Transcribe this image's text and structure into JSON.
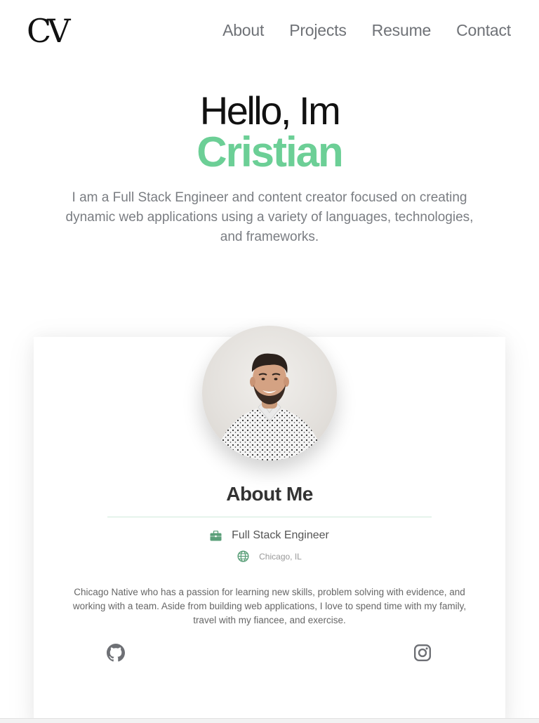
{
  "header": {
    "logo_text": "CV",
    "nav": [
      {
        "label": "About"
      },
      {
        "label": "Projects"
      },
      {
        "label": "Resume"
      },
      {
        "label": "Contact"
      }
    ]
  },
  "hero": {
    "greeting": "Hello, Im",
    "name": "Cristian",
    "description": "I am a Full Stack Engineer and content creator focused on creating dynamic web applications using a variety of languages, technologies, and frameworks."
  },
  "about": {
    "title": "About Me",
    "job_title": "Full Stack Engineer",
    "location": "Chicago, IL",
    "bio": "Chicago Native who has a passion for learning new skills, problem solving with evidence, and working with a team. Aside from building web applications, I love to spend time with my family, travel with my fiancee, and exercise.",
    "job_icon": "briefcase-icon",
    "location_icon": "globe-icon",
    "social": [
      {
        "icon": "github-icon"
      },
      {
        "icon": "instagram-icon"
      }
    ]
  },
  "colors": {
    "accent": "#6ccf96",
    "icon_green": "#5a9f79",
    "text_gray": "#7a7d82"
  }
}
